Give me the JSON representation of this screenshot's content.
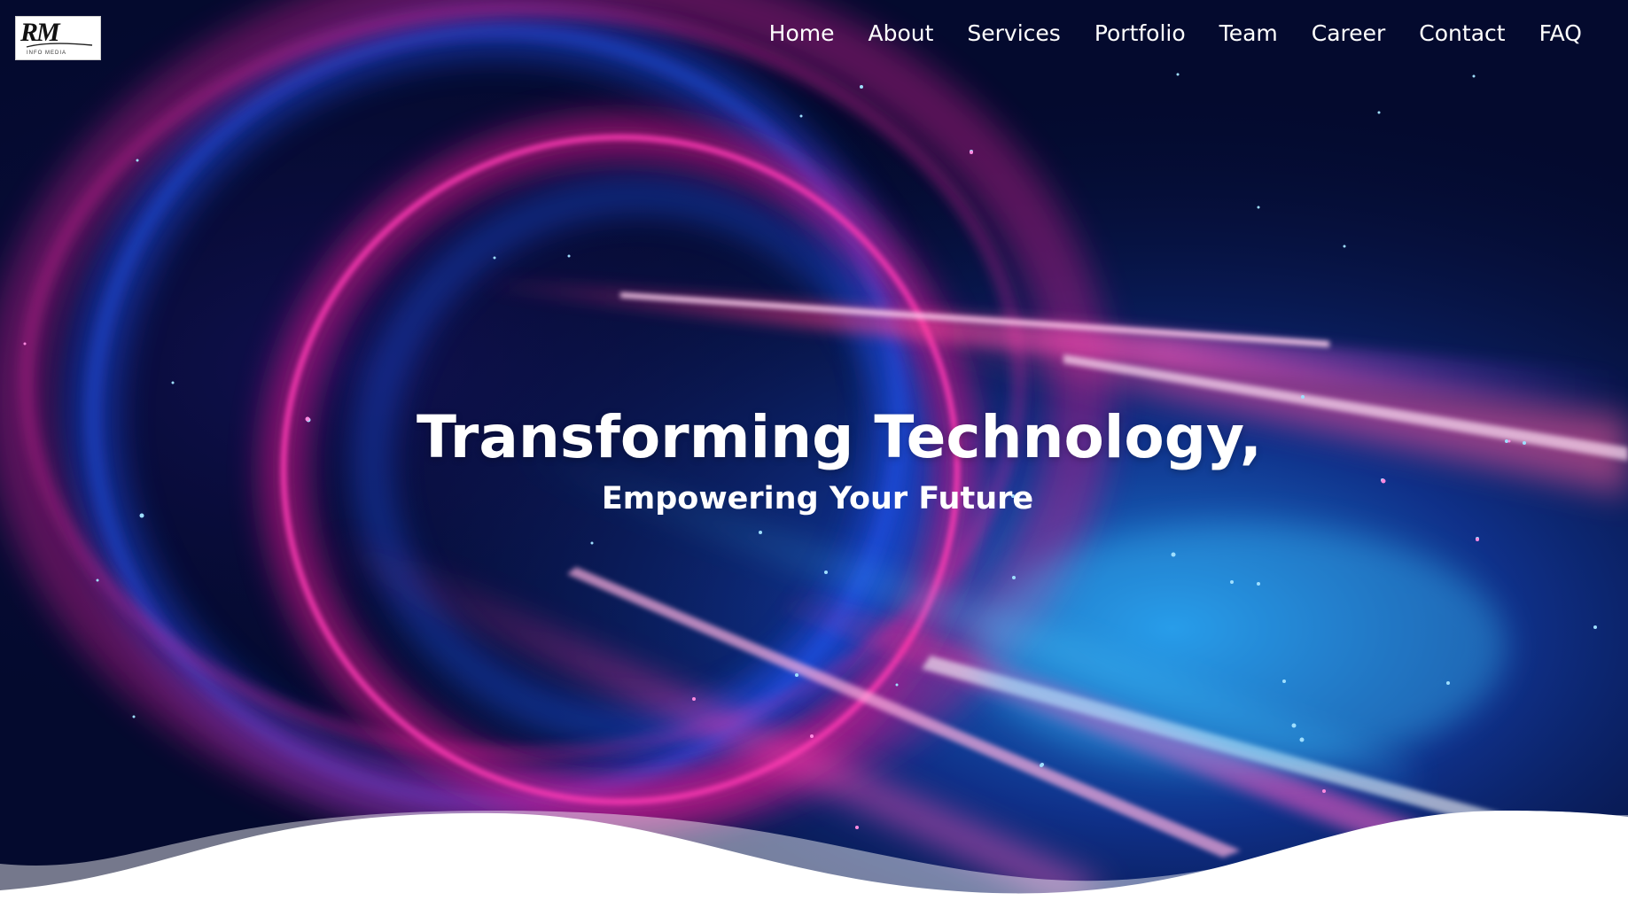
{
  "logo": {
    "mark": "RM",
    "sub": "INFO MEDIA"
  },
  "nav": {
    "items": [
      {
        "label": "Home"
      },
      {
        "label": "About"
      },
      {
        "label": "Services"
      },
      {
        "label": "Portfolio"
      },
      {
        "label": "Team"
      },
      {
        "label": "Career"
      },
      {
        "label": "Contact"
      },
      {
        "label": "FAQ"
      }
    ]
  },
  "hero": {
    "headline": "Transforming Technology,",
    "subheadline": "Empowering Your Future"
  },
  "colors": {
    "background": "#040a2e",
    "pink": "#ff2aa8",
    "blue": "#1e4fd8",
    "cyan": "#2fb8ff",
    "text": "#ffffff",
    "wave": "#ffffff"
  }
}
